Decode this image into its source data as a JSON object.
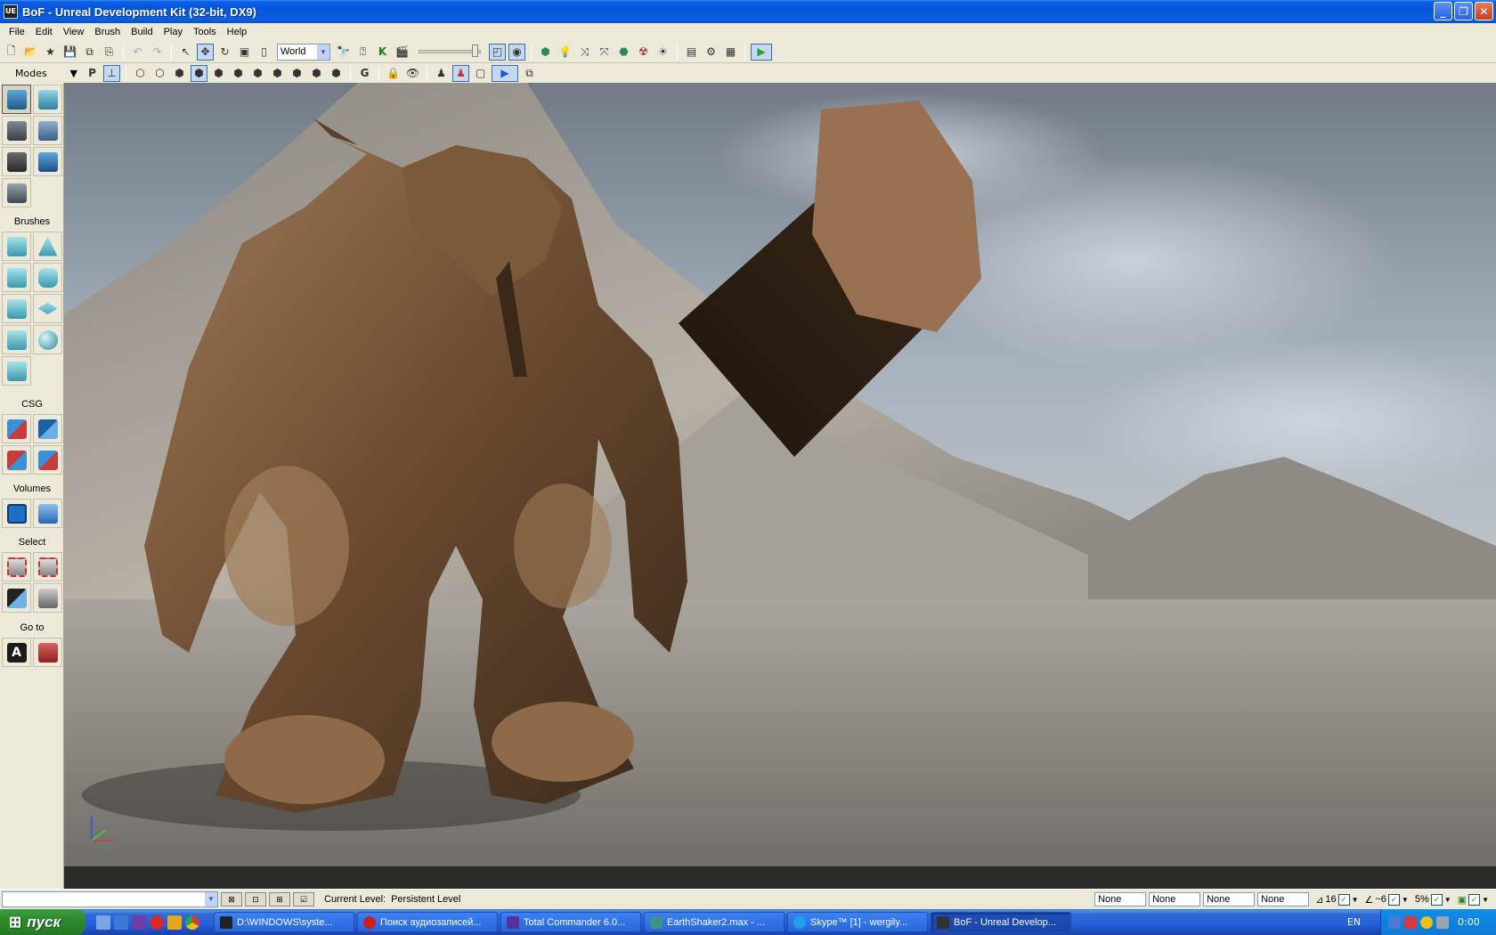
{
  "window": {
    "title": "BoF - Unreal Development Kit (32-bit, DX9)",
    "app_icon_text": "UE",
    "min": "_",
    "max": "❐",
    "close": "✕"
  },
  "menu": [
    "File",
    "Edit",
    "View",
    "Brush",
    "Build",
    "Play",
    "Tools",
    "Help"
  ],
  "toolbar": {
    "coord_system": "World",
    "play_icon": "▶"
  },
  "modes_label": "Modes",
  "left_panel": {
    "sections": {
      "brushes": "Brushes",
      "csg": "CSG",
      "volumes": "Volumes",
      "select": "Select",
      "goto": "Go to"
    }
  },
  "status": {
    "current_level_label": "Current Level:",
    "current_level_value": "Persistent Level",
    "drag_grid": [
      "None",
      "None",
      "None",
      "None"
    ],
    "grid_size": "16",
    "rotation_snap": "~6",
    "scale_snap": "5%"
  },
  "taskbar": {
    "start_label": "пуск",
    "tasks": [
      {
        "label": "D:\\WINDOWS\\syste...",
        "color": "#222222"
      },
      {
        "label": "Поиск аудиозаписей...",
        "color": "#cc1f1f"
      },
      {
        "label": "Total Commander 6.0...",
        "color": "#5a2f9e"
      },
      {
        "label": "EarthShaker2.max - ...",
        "color": "#3f8f8a"
      },
      {
        "label": "Skype™ [1] - wergily...",
        "color": "#22a0e6"
      },
      {
        "label": "BoF - Unreal Develop...",
        "color": "#333333"
      }
    ],
    "language": "EN",
    "clock": "0:00"
  }
}
